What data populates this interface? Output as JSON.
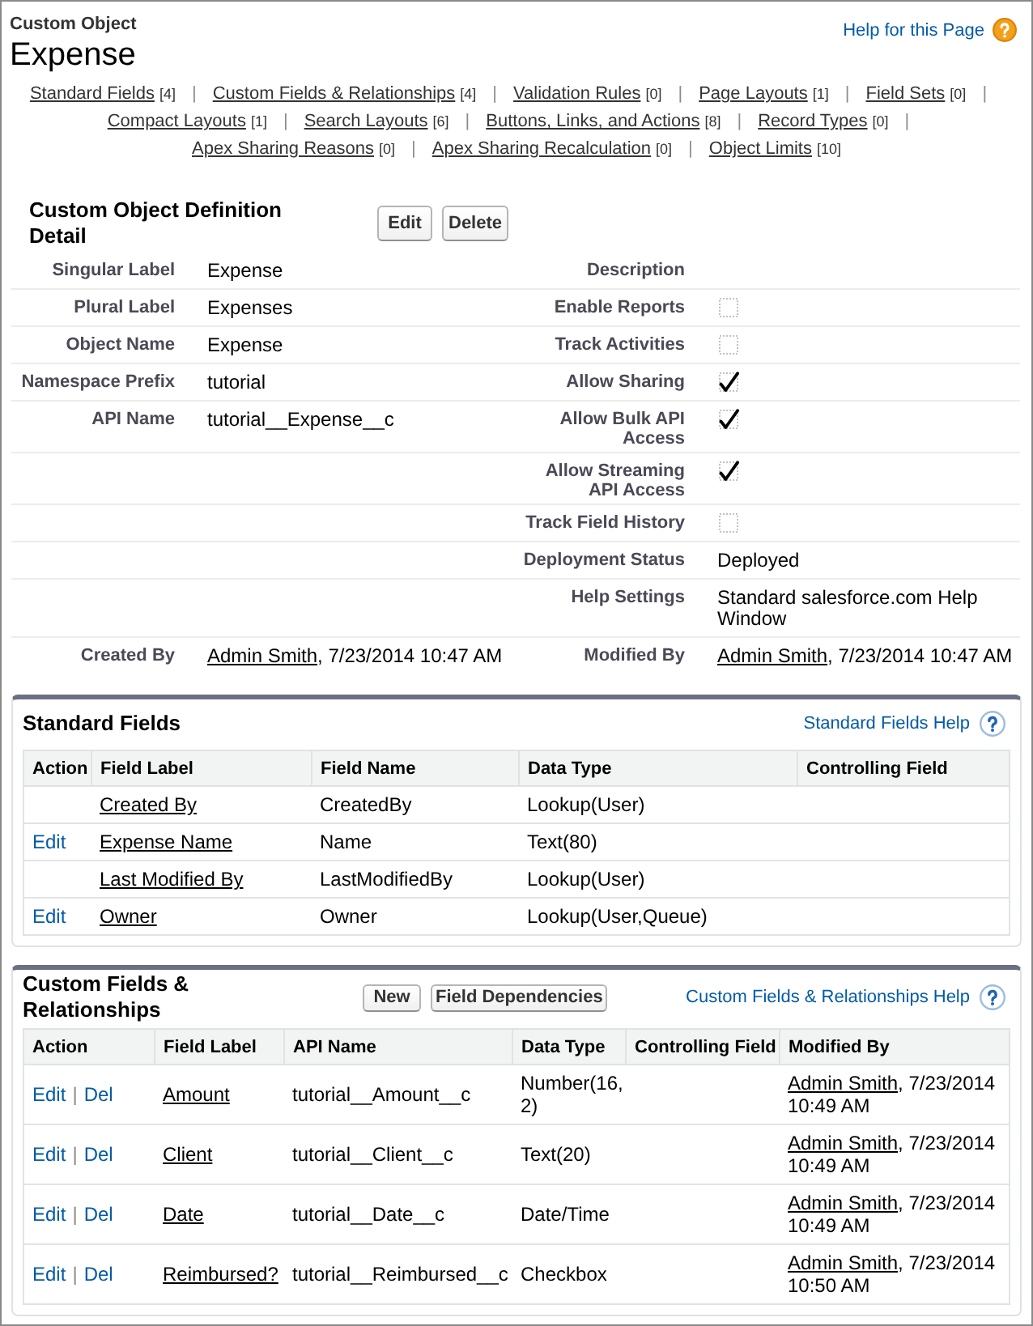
{
  "header": {
    "breadcrumb": "Custom Object",
    "title": "Expense",
    "help_link": "Help for this Page"
  },
  "nav": {
    "separator": "|",
    "links": [
      {
        "label": "Standard Fields",
        "count": "[4]"
      },
      {
        "label": "Custom Fields & Relationships",
        "count": "[4]"
      },
      {
        "label": "Validation Rules",
        "count": "[0]"
      },
      {
        "label": "Page Layouts",
        "count": "[1]"
      },
      {
        "label": "Field Sets",
        "count": "[0]"
      },
      {
        "label": "Compact Layouts",
        "count": "[1]"
      },
      {
        "label": "Search Layouts",
        "count": "[6]"
      },
      {
        "label": "Buttons, Links, and Actions",
        "count": "[8]"
      },
      {
        "label": "Record Types",
        "count": "[0]"
      },
      {
        "label": "Apex Sharing Reasons",
        "count": "[0]"
      },
      {
        "label": "Apex Sharing Recalculation",
        "count": "[0]"
      },
      {
        "label": "Object Limits",
        "count": "[10]"
      }
    ]
  },
  "detail": {
    "title": "Custom Object Definition Detail",
    "buttons": [
      "Edit",
      "Delete"
    ],
    "rows": [
      {
        "left": {
          "kind": "text",
          "label": "Singular Label",
          "value": "Expense"
        },
        "right": {
          "kind": "text",
          "label": "Description"
        }
      },
      {
        "left": {
          "kind": "text",
          "label": "Plural Label",
          "value": "Expenses"
        },
        "right": {
          "kind": "checkbox",
          "label": "Enable Reports",
          "checked": false
        }
      },
      {
        "left": {
          "kind": "text",
          "label": "Object Name",
          "value": "Expense"
        },
        "right": {
          "kind": "checkbox",
          "label": "Track Activities",
          "checked": false
        }
      },
      {
        "left": {
          "kind": "text",
          "label": "Namespace Prefix",
          "value": "tutorial"
        },
        "right": {
          "kind": "checkbox",
          "label": "Allow Sharing",
          "checked": true
        }
      },
      {
        "left": {
          "kind": "text",
          "label": "API Name",
          "value": "tutorial__Expense__c"
        },
        "right": {
          "kind": "checkbox",
          "label": "Allow Bulk API Access",
          "checked": true
        }
      },
      {
        "right": {
          "kind": "checkbox",
          "label": "Allow Streaming API Access",
          "checked": true
        }
      },
      {
        "right": {
          "kind": "checkbox",
          "label": "Track Field History",
          "checked": false
        }
      },
      {
        "right": {
          "kind": "text",
          "label": "Deployment Status",
          "value": "Deployed"
        }
      },
      {
        "right": {
          "kind": "text",
          "label": "Help Settings",
          "value": "Standard salesforce.com Help Window"
        }
      },
      {
        "left": {
          "kind": "user_date",
          "label": "Created By",
          "user": "Admin Smith",
          "date": ", 7/23/2014 10:47 AM"
        },
        "right": {
          "kind": "user_date",
          "label": "Modified By",
          "user": "Admin Smith",
          "date": ", 7/23/2014 10:47 AM"
        }
      }
    ]
  },
  "standard_fields": {
    "title": "Standard Fields",
    "help_link": "Standard Fields Help",
    "table": {
      "columns": [
        "Action",
        "Field Label",
        "Field Name",
        "Data Type",
        "Controlling Field"
      ],
      "rows": [
        {
          "field_label": "Created By",
          "field_name": "CreatedBy",
          "data_type": "Lookup(User)"
        },
        {
          "action": "Edit",
          "field_label": "Expense Name",
          "field_name": "Name",
          "data_type": "Text(80)"
        },
        {
          "field_label": "Last Modified By",
          "field_name": "LastModifiedBy",
          "data_type": "Lookup(User)"
        },
        {
          "action": "Edit",
          "field_label": "Owner",
          "field_name": "Owner",
          "data_type": "Lookup(User,Queue)"
        }
      ]
    }
  },
  "custom_fields": {
    "title": "Custom Fields & Relationships",
    "buttons": [
      "New",
      "Field Dependencies"
    ],
    "help_link": "Custom Fields & Relationships Help",
    "table": {
      "columns": [
        "Action",
        "Field Label",
        "API Name",
        "Data Type",
        "Controlling Field",
        "Modified By"
      ],
      "action_separator": "|",
      "rows": [
        {
          "actions": [
            "Edit",
            "Del"
          ],
          "field_label": "Amount",
          "api_name": "tutorial__Amount__c",
          "data_type": "Number(16, 2)",
          "modified_by": {
            "user": "Admin Smith",
            "date": ", 7/23/2014 10:49 AM"
          }
        },
        {
          "actions": [
            "Edit",
            "Del"
          ],
          "field_label": "Client",
          "api_name": "tutorial__Client__c",
          "data_type": "Text(20)",
          "modified_by": {
            "user": "Admin Smith",
            "date": ", 7/23/2014 10:49 AM"
          }
        },
        {
          "actions": [
            "Edit",
            "Del"
          ],
          "field_label": "Date",
          "api_name": "tutorial__Date__c",
          "data_type": "Date/Time",
          "modified_by": {
            "user": "Admin Smith",
            "date": ", 7/23/2014 10:49 AM"
          }
        },
        {
          "actions": [
            "Edit",
            "Del"
          ],
          "field_label": "Reimbursed?",
          "api_name": "tutorial__Reimbursed__c",
          "data_type": "Checkbox",
          "modified_by": {
            "user": "Admin Smith",
            "date": ", 7/23/2014 10:50 AM"
          }
        }
      ]
    }
  }
}
